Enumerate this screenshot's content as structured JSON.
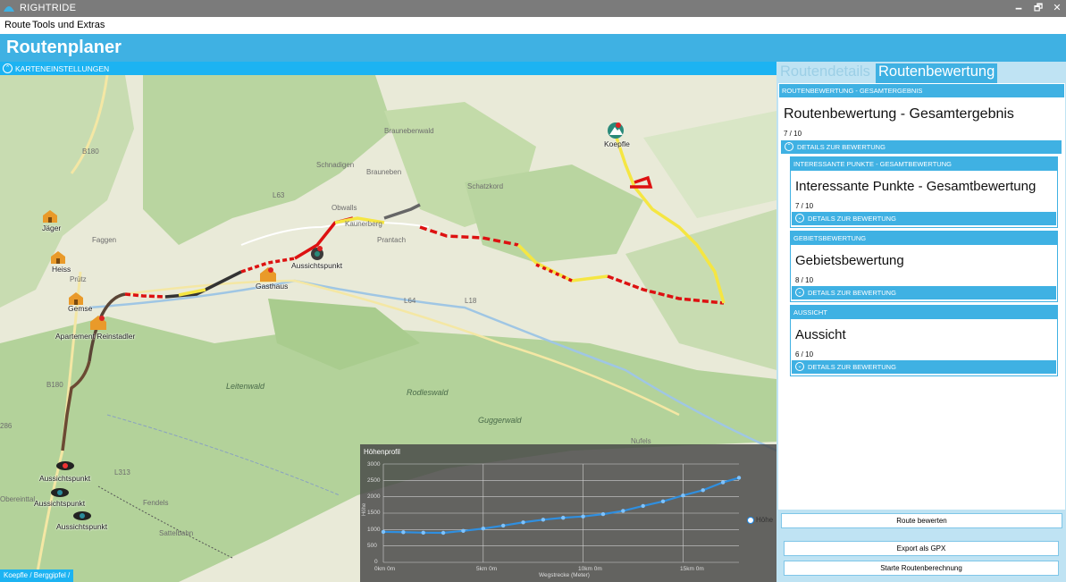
{
  "titlebar": {
    "title": "RIGHTRIDE",
    "minimize": "🗕",
    "restore": "🗗",
    "close": "✕"
  },
  "menu": {
    "route": "Route",
    "tools": "Tools und Extras"
  },
  "header": {
    "title": "Routenplaner"
  },
  "map_settings": {
    "label": "KARTENEINSTELLUNGEN",
    "toggle": "⌃"
  },
  "map": {
    "labels": {
      "braunebenwald": "Braunebenwald",
      "schnadigen": "Schnadigen",
      "brauneben": "Brauneben",
      "schatzkord": "Schatzkord",
      "obwalls": "Obwalls",
      "faggen": "Faggen",
      "pruetz": "Prütz",
      "prantach": "Prantach",
      "kaunerberg": "Kaunerberg",
      "leitenwald": "Leitenwald",
      "rodleswald": "Rodleswald",
      "guggerwald": "Guggerwald",
      "nufels": "Nufels",
      "fendels": "Fendels",
      "obereinttal": "Obereinttal",
      "sattelbahn": "Sattelbahn",
      "b180a": "B180",
      "b180b": "B180",
      "l63": "L63",
      "l64": "L64",
      "l18": "L18",
      "l313": "L313",
      "r286": "286"
    },
    "pois": {
      "koepfle": "Koepfle",
      "jaeger": "Jäger",
      "heiss": "Heiss",
      "gemse": "Gemse",
      "apartement": "Apartement Reinstadler",
      "gasthaus": "Gasthaus",
      "aussicht_center": "Aussichtspunkt",
      "aussicht_1": "Aussichtspunkt",
      "aussicht_2": "Aussichtspunkt",
      "aussicht_3": "Aussichtspunkt"
    },
    "breadcrumb": "Koepfle / Berggipfel /"
  },
  "profile": {
    "title": "Höhenprofil",
    "y_axis_label": "Höhe",
    "x_axis_label": "Wegstrecke (Meter)",
    "legend": "Höhe",
    "y_ticks": [
      "3000",
      "2500",
      "2000",
      "1500",
      "1000",
      "500",
      "0"
    ],
    "x_ticks": [
      "0km 0m",
      "5km 0m",
      "10km 0m",
      "15km 0m"
    ]
  },
  "chart_data": {
    "type": "scatter",
    "title": "Höhenprofil",
    "xlabel": "Wegstrecke (Meter)",
    "ylabel": "Höhe",
    "ylim": [
      0,
      3000
    ],
    "xlim": [
      0,
      17800
    ],
    "y_ticks": [
      0,
      500,
      1000,
      1500,
      2000,
      2500,
      3000
    ],
    "x_ticks": [
      0,
      5000,
      10000,
      15000
    ],
    "x_tick_labels": [
      "0km 0m",
      "5km 0m",
      "10km 0m",
      "15km 0m"
    ],
    "series": [
      {
        "name": "Höhe",
        "x": [
          0,
          1000,
          2000,
          3000,
          4000,
          5000,
          6000,
          7000,
          8000,
          9000,
          10000,
          11000,
          12000,
          13000,
          14000,
          15000,
          16000,
          17000,
          17800
        ],
        "y": [
          930,
          920,
          905,
          900,
          960,
          1030,
          1120,
          1220,
          1300,
          1360,
          1400,
          1470,
          1570,
          1720,
          1860,
          2040,
          2200,
          2440,
          2580
        ]
      }
    ],
    "grid": true,
    "legend_position": "right"
  },
  "tabs": {
    "details": "Routendetails",
    "rating": "Routenbewertung"
  },
  "rating": {
    "header": "ROUTENBEWERTUNG - GESAMTERGEBNIS",
    "title": "Routenbewertung - Gesamtergebnis",
    "score": "7  /  10",
    "details_label": "DETAILS ZUR BEWERTUNG",
    "sections": [
      {
        "header": "INTERESSANTE PUNKTE - GESAMTBEWERTUNG",
        "title": "Interessante Punkte - Gesamtbewertung",
        "score": "7  /  10",
        "details_label": "DETAILS ZUR BEWERTUNG"
      },
      {
        "header": "GEBIETSBEWERTUNG",
        "title": "Gebietsbewertung",
        "score": "8  /  10",
        "details_label": "DETAILS ZUR BEWERTUNG"
      },
      {
        "header": "AUSSICHT",
        "title": "Aussicht",
        "score": "6  /  10",
        "details_label": "DETAILS ZUR BEWERTUNG"
      }
    ]
  },
  "buttons": {
    "rate": "Route bewerten",
    "export": "Export als GPX",
    "start": "Starte Routenberechnung"
  }
}
